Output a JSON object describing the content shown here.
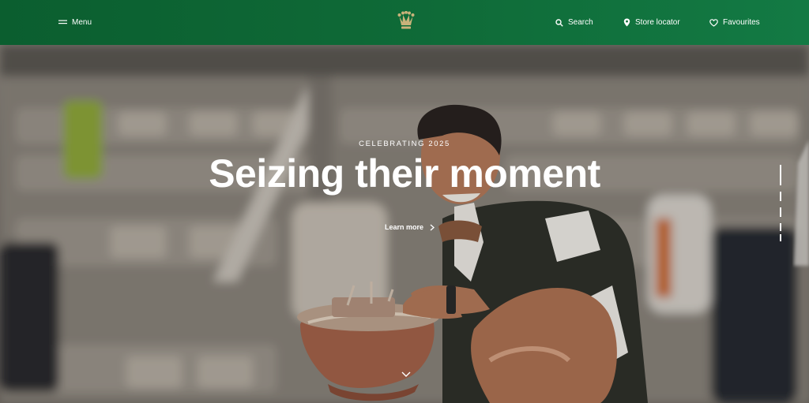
{
  "header": {
    "menu_label": "Menu",
    "search_label": "Search",
    "store_label": "Store locator",
    "favourites_label": "Favourites"
  },
  "hero": {
    "eyebrow": "CELEBRATING 2025",
    "title": "Seizing their moment",
    "cta_label": "Learn more"
  },
  "colors": {
    "header_green": "#0f6b38",
    "logo_gold": "#c9b27a",
    "text": "#ffffff"
  },
  "icons": {
    "menu": "hamburger-icon",
    "search": "search-icon",
    "store": "location-pin-icon",
    "favourites": "heart-icon",
    "cta": "chevron-right-icon",
    "scroll": "chevron-down-icon"
  }
}
